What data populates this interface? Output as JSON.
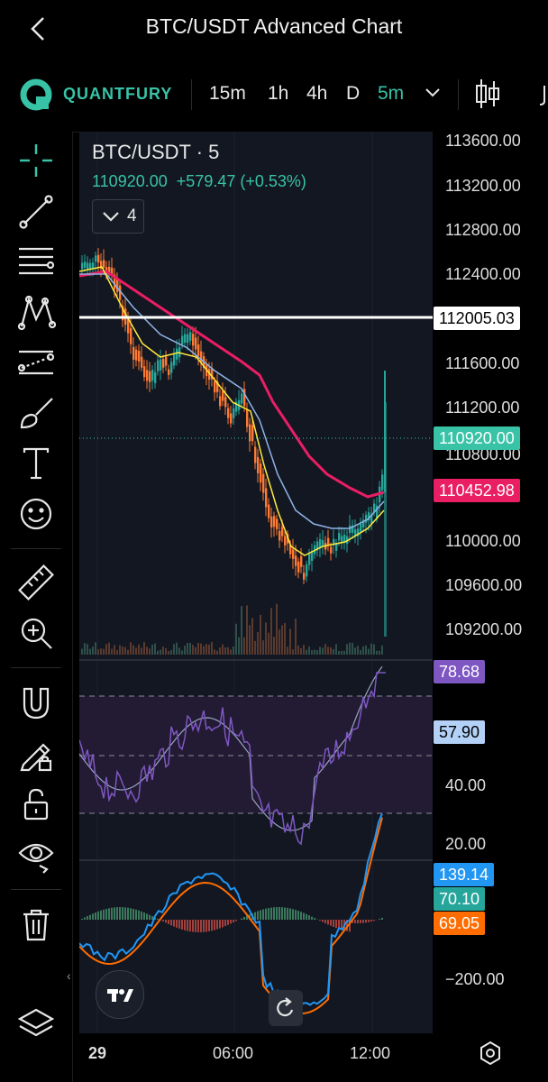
{
  "header": {
    "title": "BTC/USDT Advanced Chart"
  },
  "toolbar": {
    "brand": "QUANTFURY",
    "timeframes": [
      "15m",
      "1h",
      "4h",
      "D"
    ],
    "active_timeframe": "5m",
    "chevron_icon": "chevron-down-icon",
    "chart_type_icon": "candlestick-icon"
  },
  "tools": [
    "crosshair-icon",
    "trend-line-icon",
    "fib-icon",
    "pattern-icon",
    "prediction-icon",
    "brush-icon",
    "text-icon",
    "emoji-icon",
    "ruler-icon",
    "zoom-icon",
    "magnet-icon",
    "lock-drawing-icon",
    "unlock-icon",
    "eye-icon",
    "trash-icon",
    "layers-icon"
  ],
  "legend": {
    "symbol": "BTC/USDT · 5",
    "last": "110920.00",
    "change": "+579.47 (+0.53%)",
    "indicators_count": "4"
  },
  "price_scale": {
    "ticks": [
      "113600.00",
      "113200.00",
      "112800.00",
      "112400.00",
      "111600.00",
      "111200.00",
      "110800.00",
      "110000.00",
      "109600.00",
      "109200.00"
    ],
    "tags": {
      "line": "112005.03",
      "last": "110920.00",
      "ema": "110452.98"
    }
  },
  "rsi": {
    "value": "78.68",
    "ma": "57.90",
    "ticks": [
      "40.00",
      "20.00"
    ]
  },
  "macd": {
    "macd": "139.14",
    "signal": "70.10",
    "hist": "69.05",
    "tick": "−200.00"
  },
  "time_axis": {
    "labels": [
      "29",
      "06:00",
      "12:00"
    ]
  },
  "colors": {
    "accent": "#38c3a7",
    "ema_pink": "#e91e63",
    "ema_blue": "#8fb4e6",
    "ema_yellow": "#ffeb3b",
    "rsi_purple": "#7e57c2",
    "macd_blue": "#2196f3",
    "macd_orange": "#ff6d00"
  }
}
